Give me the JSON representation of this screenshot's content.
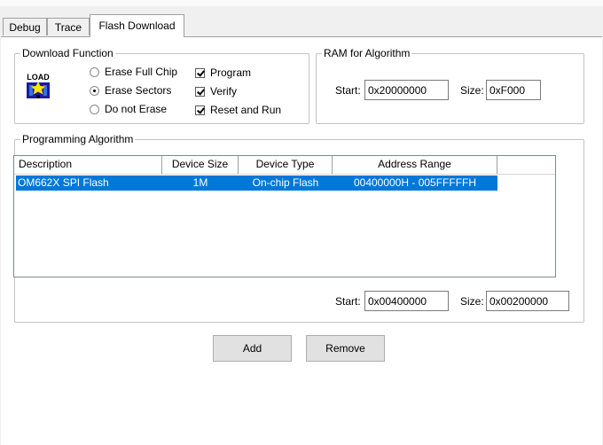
{
  "tabs": [
    {
      "label": "Debug",
      "active": false
    },
    {
      "label": "Trace",
      "active": false
    },
    {
      "label": "Flash Download",
      "active": true
    }
  ],
  "download_function": {
    "title": "Download Function",
    "icon": "load-icon",
    "icon_text": "LOAD",
    "radios": [
      {
        "label": "Erase Full Chip",
        "selected": false
      },
      {
        "label": "Erase Sectors",
        "selected": true
      },
      {
        "label": "Do not Erase",
        "selected": false
      }
    ],
    "checks": [
      {
        "label": "Program",
        "checked": true
      },
      {
        "label": "Verify",
        "checked": true
      },
      {
        "label": "Reset and Run",
        "checked": true
      }
    ]
  },
  "ram": {
    "title": "RAM for Algorithm",
    "start_label": "Start:",
    "start_value": "0x20000000",
    "size_label": "Size:",
    "size_value": "0xF000"
  },
  "programming": {
    "title": "Programming Algorithm",
    "columns": [
      "Description",
      "Device Size",
      "Device Type",
      "Address Range"
    ],
    "rows": [
      {
        "description": "OM662X SPI Flash",
        "size": "1M",
        "type": "On-chip Flash",
        "range": "00400000H - 005FFFFFH",
        "selected": true
      }
    ],
    "start_label": "Start:",
    "start_value": "0x00400000",
    "size_label": "Size:",
    "size_value": "0x00200000"
  },
  "buttons": {
    "add": "Add",
    "remove": "Remove"
  },
  "colors": {
    "selection": "#0078d7",
    "panel": "#ffffff",
    "background": "#f0f0f0"
  }
}
